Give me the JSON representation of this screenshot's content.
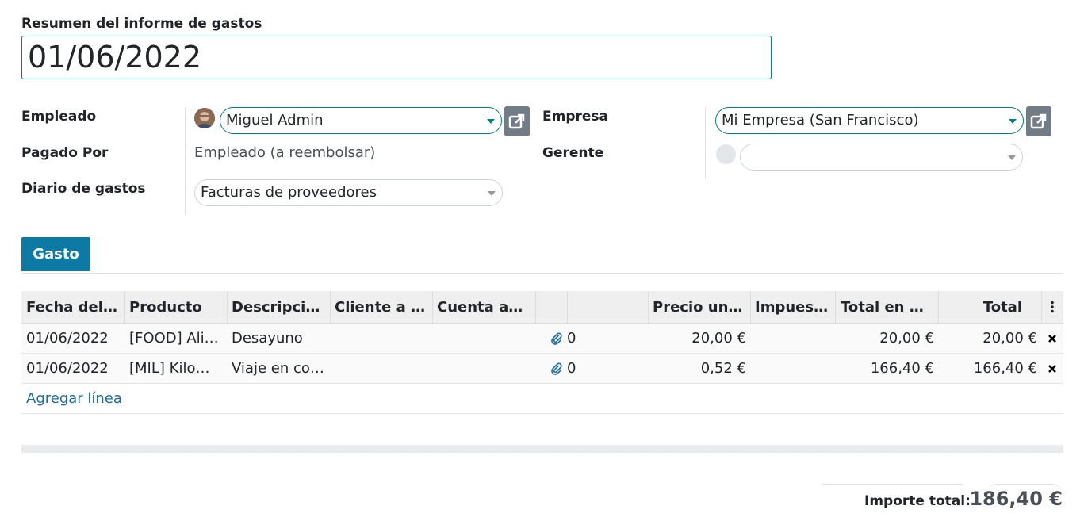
{
  "summary": {
    "label": "Resumen del informe de gastos",
    "value": "01/06/2022"
  },
  "fields": {
    "employee": {
      "label": "Empleado",
      "value": "Miguel Admin"
    },
    "paid_by": {
      "label": "Pagado Por",
      "value": "Empleado (a reembolsar)"
    },
    "journal": {
      "label": "Diario de gastos",
      "value": "Facturas de proveedores"
    },
    "company": {
      "label": "Empresa",
      "value": "Mi Empresa (San Francisco)"
    },
    "manager": {
      "label": "Gerente",
      "value": ""
    }
  },
  "tabs": [
    {
      "label": "Gasto",
      "active": true
    }
  ],
  "table": {
    "headers": [
      "Fecha del g…",
      "Producto",
      "Descripció…",
      "Cliente a re…",
      "Cuenta an…",
      "",
      "",
      "Precio unit…",
      "Impuest…",
      "Total en m…",
      "Total"
    ],
    "rows": [
      {
        "date": "01/06/2022",
        "product": "[FOOD] Alim…",
        "description": "Desayuno",
        "attachments": "0",
        "unit_price": "20,00 €",
        "total_company": "20,00 €",
        "total": "20,00 €"
      },
      {
        "date": "01/06/2022",
        "product": "[MIL] Kilome…",
        "description": "Viaje en coc…",
        "attachments": "0",
        "unit_price": "0,52 €",
        "total_company": "166,40 €",
        "total": "166,40 €"
      }
    ],
    "add_line": "Agregar línea"
  },
  "totals": {
    "label": "Importe total:",
    "value": "186,40 €"
  },
  "icons": {
    "external": "external-link-icon",
    "attachment": "paperclip-icon",
    "delete": "close-icon",
    "options": "kebab-menu-icon"
  },
  "colors": {
    "accent": "#017e84",
    "tab": "#0d7aa5",
    "link": "#1e6f99",
    "button": "#717c87"
  }
}
